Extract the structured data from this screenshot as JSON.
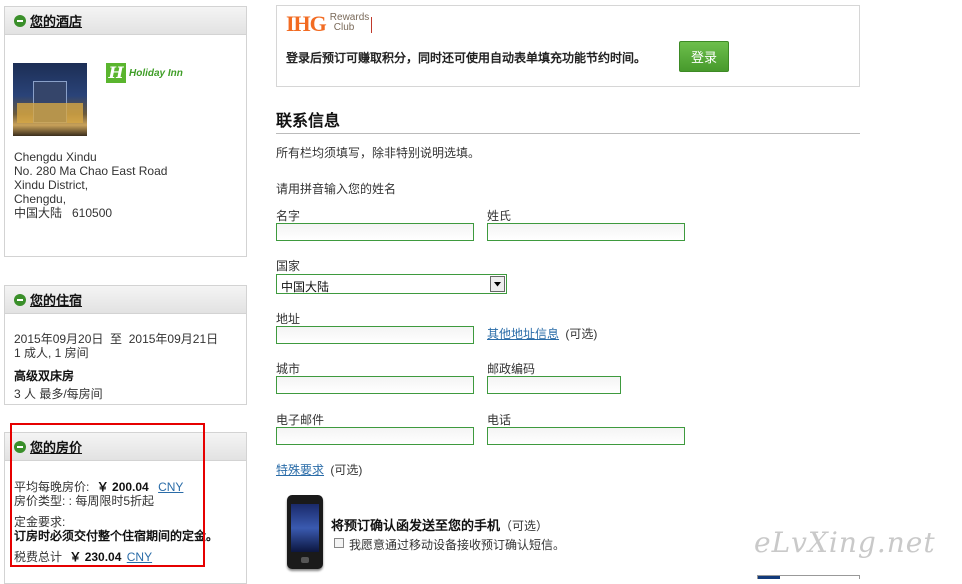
{
  "hotel_panel": {
    "title": "您的酒店",
    "brand": "Holiday Inn",
    "address_lines": [
      "Chengdu Xindu",
      "No. 280 Ma Chao East Road",
      "Xindu District,",
      "Chengdu,",
      "中国大陆   610500"
    ]
  },
  "stay_panel": {
    "title": "您的住宿",
    "dates": "2015年09月20日  至  2015年09月21日",
    "guests": "1 成人, 1 房间",
    "room_type": "高级双床房",
    "occupancy": "3 人 最多/每房间"
  },
  "price_panel": {
    "title": "您的房价",
    "avg_label": "平均每晚房价:",
    "avg_value": "￥ 200.04",
    "currency": "CNY",
    "rate_type": "房价类型: : 每周限时5折起",
    "deposit_label": "定金要求:",
    "deposit_note": "订房时必须交付整个住宿期间的定金。",
    "total_label": "税费总计",
    "total_value": "￥ 230.04"
  },
  "rewards": {
    "logo_text": "IHG",
    "logo_sub1": "Rewards",
    "logo_sub2": "Club",
    "message": "登录后预订可赚取积分，同时还可使用自动表单填充功能节约时间。",
    "login_button": "登录"
  },
  "contact": {
    "heading": "联系信息",
    "note": "所有栏均须填写，除非特别说明选填。",
    "name_hint": "请用拼音输入您的姓名",
    "first_name_label": "名字",
    "last_name_label": "姓氏",
    "country_label": "国家",
    "country_value": "中国大陆",
    "address_label": "地址",
    "other_address_link": "其他地址信息",
    "optional": "(可选)",
    "city_label": "城市",
    "postal_label": "邮政编码",
    "email_label": "电子邮件",
    "phone_label": "电话",
    "special_request_link": "特殊要求",
    "special_optional": "(可选)"
  },
  "mobile": {
    "heading": "将预订确认函发送至您的手机",
    "optional": "（可选）",
    "checkbox_label": "我愿意通过移动设备接收预订确认短信。"
  },
  "watermark": "eLvXing.net",
  "colors": {
    "green_border": "#3e9a3e",
    "login_button": "#5aad3c",
    "highlight_box": "#e60000",
    "ihg_orange": "#f26b22"
  }
}
